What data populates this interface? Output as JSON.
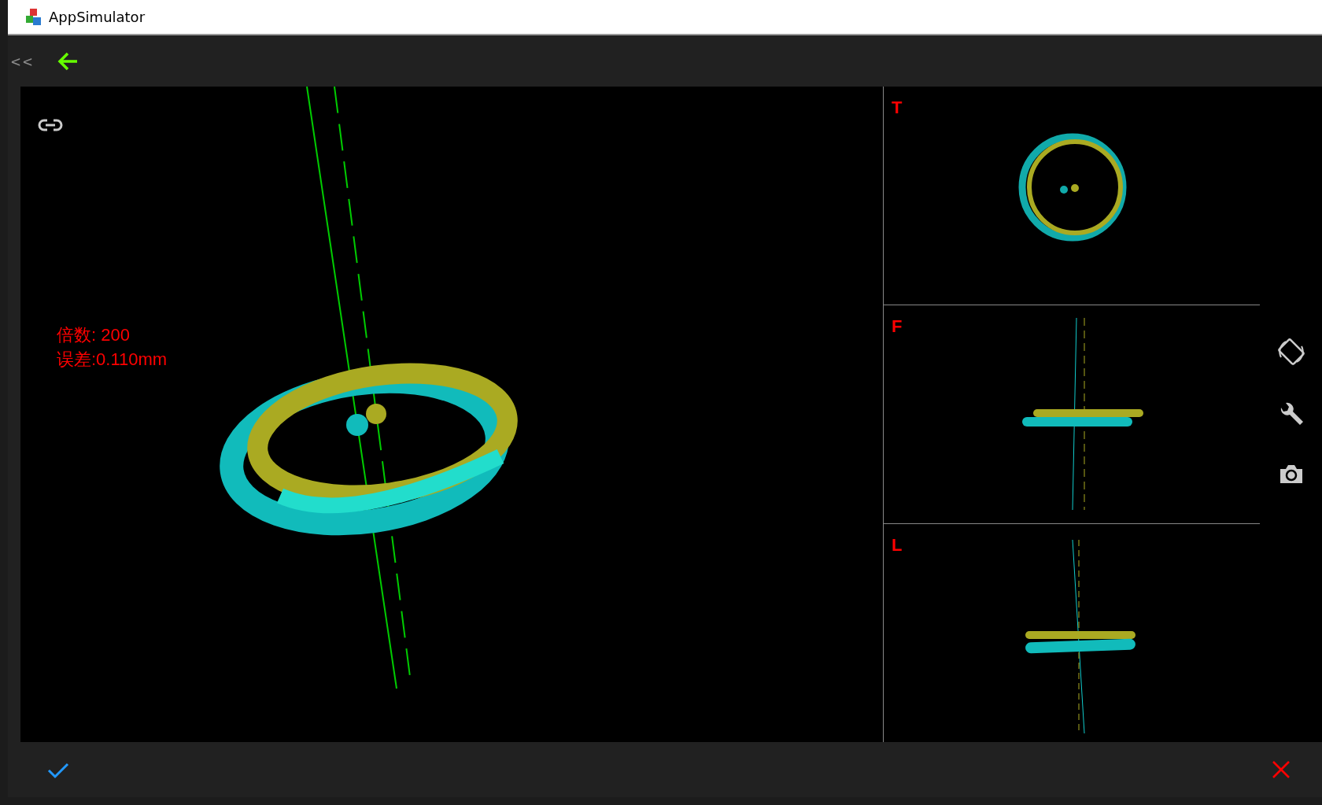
{
  "window": {
    "title": "AppSimulator"
  },
  "toolbar": {
    "collapse": "<<"
  },
  "main_view": {
    "readouts": [
      "倍数: 200",
      "误差:0.110mm"
    ]
  },
  "side_views": [
    {
      "label": "T",
      "kind": "top"
    },
    {
      "label": "F",
      "kind": "front"
    },
    {
      "label": "L",
      "kind": "left"
    }
  ]
}
